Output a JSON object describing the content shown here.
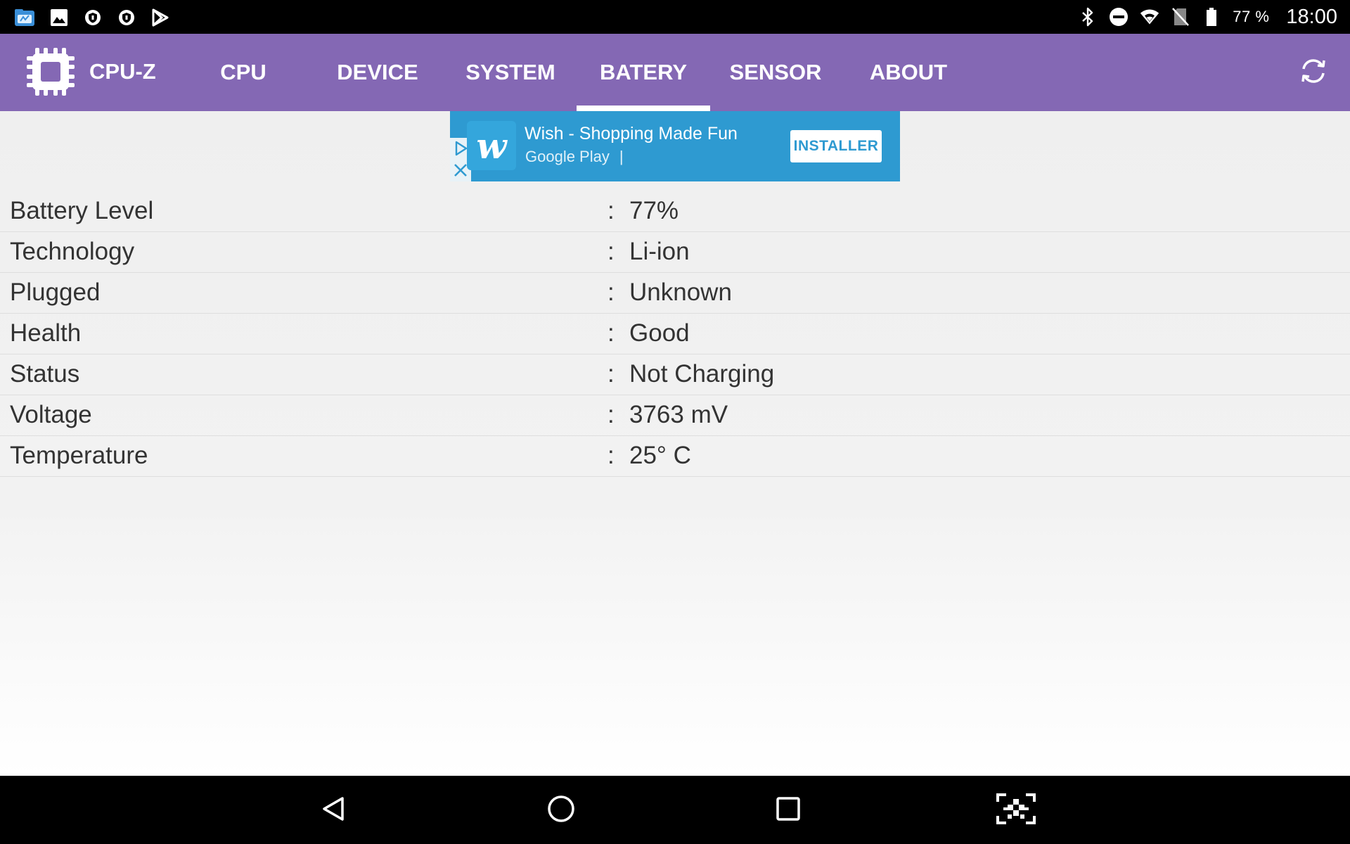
{
  "status_bar": {
    "notification_icons": [
      "file-explorer-icon",
      "gallery-icon",
      "shield-icon",
      "shield-icon",
      "play-store-icon"
    ],
    "system_icons": [
      "bluetooth-icon",
      "do-not-disturb-icon",
      "wifi-icon",
      "no-sim-icon",
      "battery-icon"
    ],
    "battery_percent": "77 %",
    "time": "18:00"
  },
  "app_bar": {
    "title": "CPU-Z",
    "logo_icon": "chip-icon",
    "tabs": [
      {
        "label": "CPU",
        "active": false
      },
      {
        "label": "DEVICE",
        "active": false
      },
      {
        "label": "SYSTEM",
        "active": false
      },
      {
        "label": "BATERY",
        "active": true
      },
      {
        "label": "SENSOR",
        "active": false
      },
      {
        "label": "ABOUT",
        "active": false
      }
    ],
    "refresh_icon": "refresh-icon"
  },
  "ad": {
    "title": "Wish - Shopping Made Fun",
    "store": "Google Play",
    "store_separator": "|",
    "app_icon_letter": "w",
    "install_label": "INSTALLER"
  },
  "battery_info": {
    "rows": [
      {
        "label": "Battery Level",
        "separator": ":",
        "value": "77%"
      },
      {
        "label": "Technology",
        "separator": ":",
        "value": "Li-ion"
      },
      {
        "label": "Plugged",
        "separator": ":",
        "value": "Unknown"
      },
      {
        "label": "Health",
        "separator": ":",
        "value": "Good"
      },
      {
        "label": "Status",
        "separator": ":",
        "value": "Not Charging"
      },
      {
        "label": "Voltage",
        "separator": ":",
        "value": "3763 mV"
      },
      {
        "label": "Temperature",
        "separator": ":",
        "value": "25° C"
      }
    ]
  },
  "nav_bar": {
    "buttons": [
      "back-icon",
      "home-icon",
      "recents-icon",
      "screenshot-icon"
    ]
  },
  "colors": {
    "app_bar": "#8468b4",
    "ad_background": "#2e9ad1",
    "status_bar": "#000000",
    "nav_bar": "#000000",
    "text": "#333333"
  }
}
